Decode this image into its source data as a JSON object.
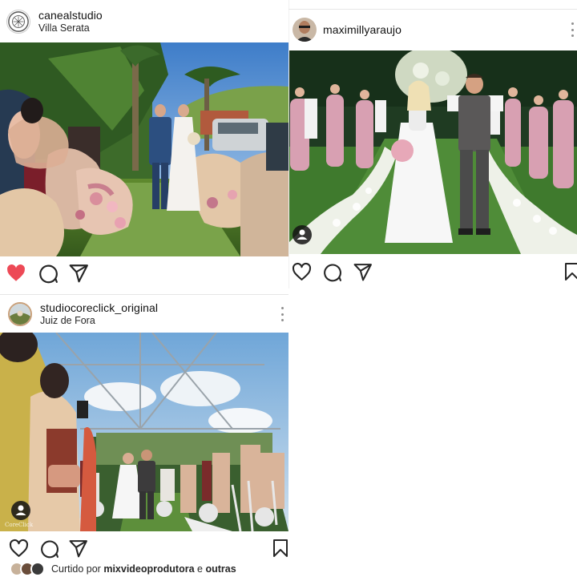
{
  "posts": [
    {
      "username": "canealstudio",
      "location": "Villa Serata",
      "liked_state": true,
      "colors": {
        "like_active": "#ed4956"
      }
    },
    {
      "username": "maximillyaraujo",
      "location": ""
    },
    {
      "username": "studiocoreclick_original",
      "location": "Juiz de Fora",
      "watermark": "CoreClick"
    }
  ],
  "liked_by": {
    "prefix": "Curtido por",
    "user": "mixvideoprodutora",
    "conjunction": "e",
    "others": "outras"
  },
  "icons": [
    "heart-icon",
    "comment-icon",
    "share-icon",
    "bookmark-icon",
    "more-icon",
    "user-tag-icon"
  ]
}
